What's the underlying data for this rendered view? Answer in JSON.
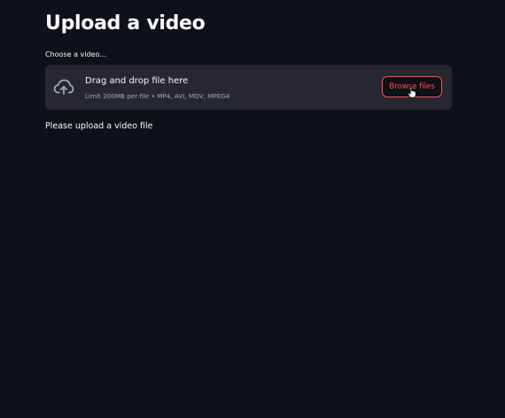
{
  "page": {
    "title": "Upload a video",
    "status_message": "Please upload a video file"
  },
  "uploader": {
    "label": "Choose a video...",
    "drop_text": "Drag and drop file here",
    "limit_text": "Limit 200MB per file • MP4, AVI, MOV, MPEG4",
    "browse_label": "Browse files",
    "icon": "cloud-upload-icon"
  },
  "cursor": {
    "icon": "hand-pointer-icon"
  },
  "colors": {
    "background": "#0e1117",
    "dropzone": "#262730",
    "accent": "#ff4b4b",
    "text": "#fafafa",
    "muted_text": "#a3a8b8"
  }
}
